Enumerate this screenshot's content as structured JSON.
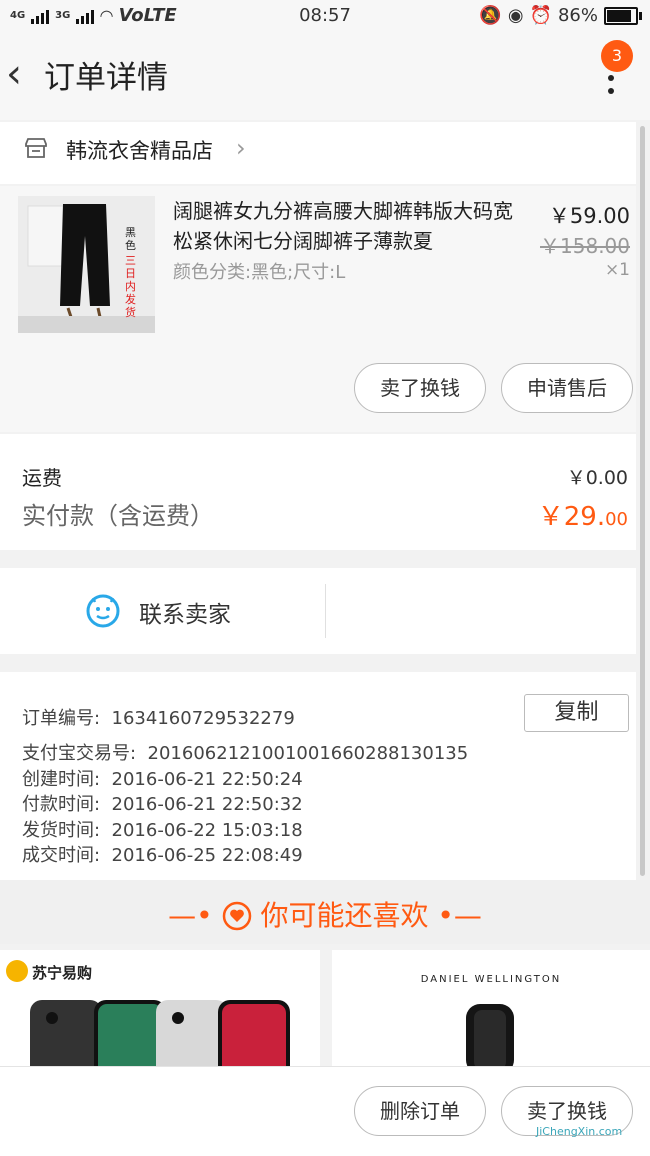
{
  "status": {
    "net1": "4G",
    "net2": "3G",
    "volte": "VoLTE",
    "time": "08:57",
    "battery": "86%"
  },
  "nav": {
    "title": "订单详情",
    "badge": "3"
  },
  "shop": {
    "name": "韩流衣舍精品店"
  },
  "item": {
    "title": "阔腿裤女九分裤高腰大脚裤韩版大码宽松紧休闲七分阔脚裤子薄款夏",
    "sku": "颜色分类:黑色;尺寸:L",
    "price": "￥59.00",
    "orig_price": "￥158.00",
    "qty": "×1",
    "thumb_tag": "黑色",
    "thumb_promo": "三日内发货",
    "btn_sell": "卖了换钱",
    "btn_aftersale": "申请售后"
  },
  "fee": {
    "shipping_label": "运费",
    "shipping_value": "￥0.00",
    "paid_label": "实付款（含运费）",
    "paid_main": "￥29.",
    "paid_cents": "00"
  },
  "contact": {
    "label": "联系卖家"
  },
  "order": {
    "copy": "复制",
    "rows": [
      {
        "label": "订单编号:",
        "value": "1634160729532279"
      },
      {
        "label": "支付宝交易号:",
        "value": "2016062121001001660288130135"
      },
      {
        "label": "创建时间:",
        "value": "2016-06-21  22:50:24"
      },
      {
        "label": "付款时间:",
        "value": "2016-06-21  22:50:32"
      },
      {
        "label": "发货时间:",
        "value": "2016-06-22  15:03:18"
      },
      {
        "label": "成交时间:",
        "value": "2016-06-25  22:08:49"
      }
    ]
  },
  "recommend": {
    "title": "你可能还喜欢",
    "card1_brand": "苏宁易购",
    "card2_brand": "DANIEL WELLINGTON"
  },
  "bottom": {
    "delete": "删除订单",
    "sell": "卖了换钱"
  },
  "watermark": "JiChengXin.com",
  "colors": {
    "accent": "#ff5a12",
    "contact_icon": "#29a8e8"
  }
}
